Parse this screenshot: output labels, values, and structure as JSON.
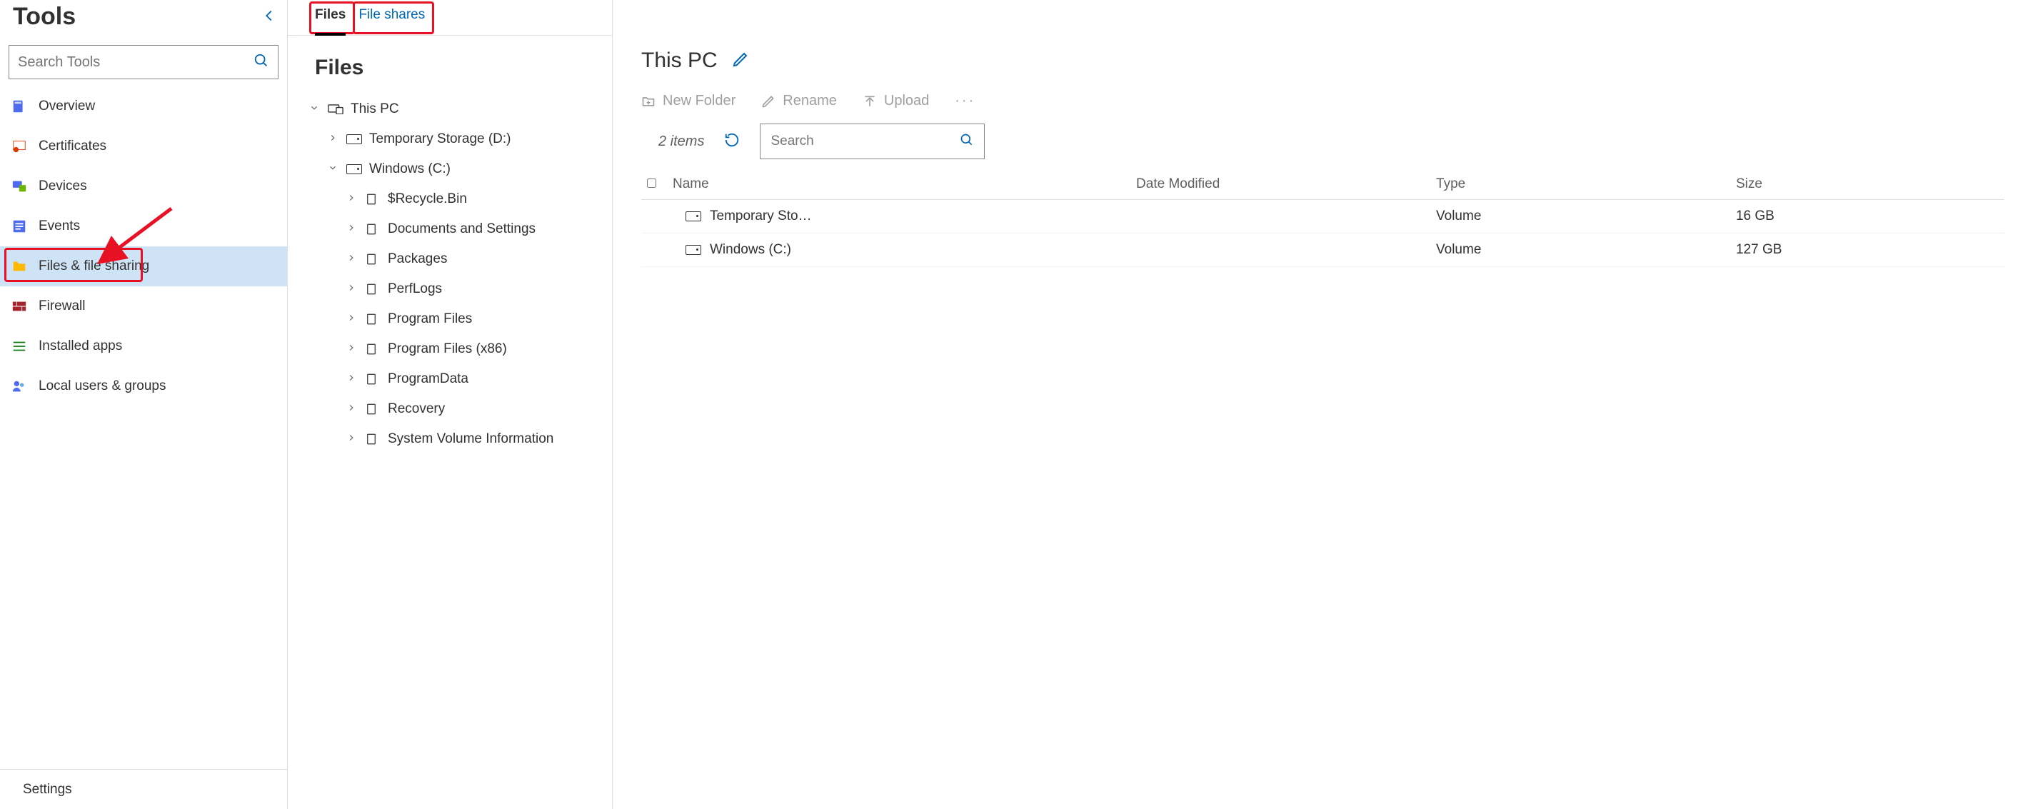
{
  "sidebar": {
    "title": "Tools",
    "search_placeholder": "Search Tools",
    "items": [
      {
        "id": "overview",
        "label": "Overview"
      },
      {
        "id": "certificates",
        "label": "Certificates"
      },
      {
        "id": "devices",
        "label": "Devices"
      },
      {
        "id": "events",
        "label": "Events"
      },
      {
        "id": "files",
        "label": "Files & file sharing",
        "selected": true,
        "highlight": true
      },
      {
        "id": "firewall",
        "label": "Firewall"
      },
      {
        "id": "installed-apps",
        "label": "Installed apps"
      },
      {
        "id": "local-users",
        "label": "Local users & groups"
      }
    ],
    "footer": {
      "label": "Settings"
    }
  },
  "tabs": [
    {
      "id": "files",
      "label": "Files",
      "active": true,
      "highlight": true
    },
    {
      "id": "file-shares",
      "label": "File shares",
      "highlight": true
    }
  ],
  "middle": {
    "title": "Files",
    "tree": {
      "label": "This PC",
      "expanded": true,
      "children": [
        {
          "label": "Temporary Storage (D:)",
          "expanded": false,
          "icon": "drive"
        },
        {
          "label": "Windows (C:)",
          "expanded": true,
          "icon": "drive",
          "children": [
            {
              "label": "$Recycle.Bin"
            },
            {
              "label": "Documents and Settings"
            },
            {
              "label": "Packages"
            },
            {
              "label": "PerfLogs"
            },
            {
              "label": "Program Files"
            },
            {
              "label": "Program Files (x86)"
            },
            {
              "label": "ProgramData"
            },
            {
              "label": "Recovery"
            },
            {
              "label": "System Volume Information"
            }
          ]
        }
      ]
    }
  },
  "right": {
    "location": "This PC",
    "toolbar": {
      "new_folder": "New Folder",
      "rename": "Rename",
      "upload": "Upload"
    },
    "items_count": "2 items",
    "search_placeholder": "Search",
    "columns": {
      "name": "Name",
      "date": "Date Modified",
      "type": "Type",
      "size": "Size"
    },
    "rows": [
      {
        "name": "Temporary Sto…",
        "date": "",
        "type": "Volume",
        "size": "16 GB"
      },
      {
        "name": "Windows (C:)",
        "date": "",
        "type": "Volume",
        "size": "127 GB"
      }
    ]
  },
  "colors": {
    "accent": "#0067b8",
    "highlight": "#e81123",
    "selection": "#cfe3f7"
  }
}
